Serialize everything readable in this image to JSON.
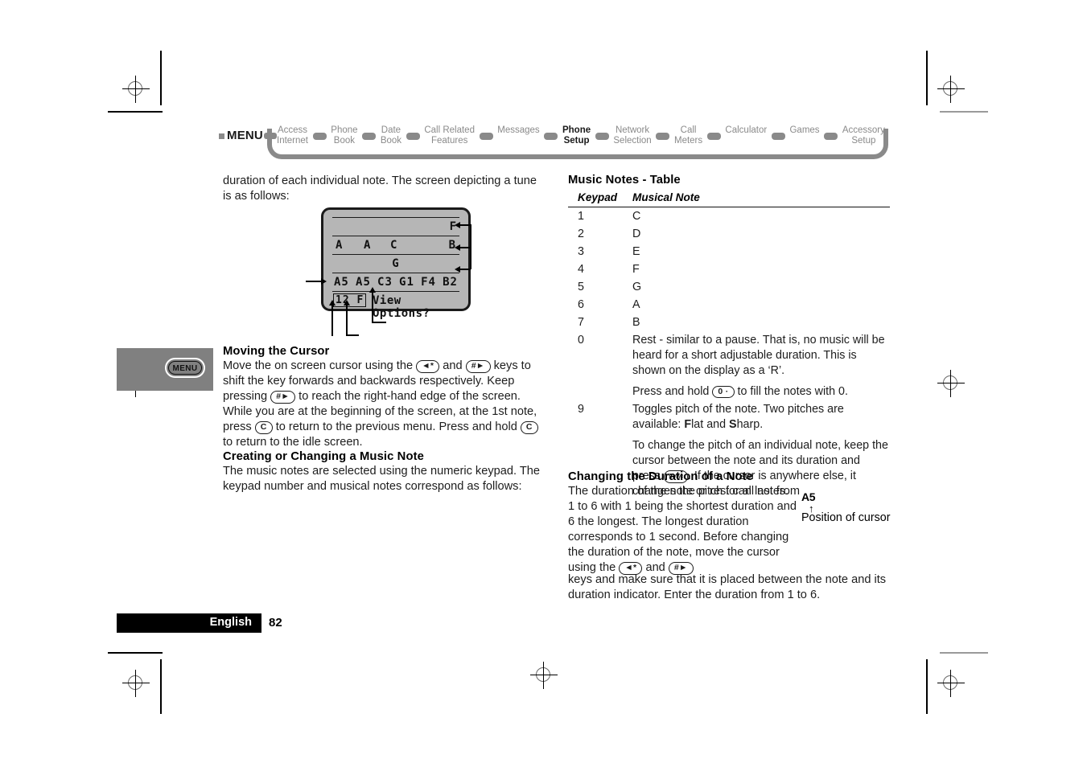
{
  "nav": {
    "menu_label": "MENU",
    "items": [
      {
        "label": "Access\nInternet",
        "active": false
      },
      {
        "label": "Phone\nBook",
        "active": false
      },
      {
        "label": "Date\nBook",
        "active": false
      },
      {
        "label": "Call Related\nFeatures",
        "active": false
      },
      {
        "label": "Messages",
        "active": false
      },
      {
        "label": "Phone\nSetup",
        "active": true
      },
      {
        "label": "Network\nSelection",
        "active": false
      },
      {
        "label": "Call\nMeters",
        "active": false
      },
      {
        "label": "Calculator",
        "active": false
      },
      {
        "label": "Games",
        "active": false
      },
      {
        "label": "Accessory\nSetup",
        "active": false
      }
    ]
  },
  "left": {
    "intro": "duration of each individual note. The screen depicting a tune is as follows:",
    "phone_screen": {
      "row1_note": "F",
      "row2_notes": [
        "A",
        "A",
        "C",
        "B"
      ],
      "row3_note": "G",
      "row4_notes": [
        "A5",
        "A5",
        "C3",
        "G1",
        "F4",
        "B2"
      ],
      "duration_box": "12 F",
      "softkey": "View Options?"
    },
    "moving_cursor": {
      "heading": "Moving the Cursor",
      "p1_a": "Move the on screen cursor using the",
      "key_star": "◄*",
      "p1_b": "and",
      "key_hash": "#►",
      "p1_c": "keys to shift the key forwards and backwards respectively. Keep pressing",
      "p1_d": "to reach the right-hand edge of the screen. While you are at the beginning of the screen, at the 1st note, press",
      "key_c": "C",
      "p1_e": "to return to the previous menu. Press and hold",
      "p1_f": "to return to the idle screen."
    },
    "creating_note": {
      "heading": "Creating or Changing a Music Note",
      "body": "The music notes are selected using the numeric keypad. The keypad number and musical notes correspond as follows:"
    },
    "icon_panel": {
      "menu_button_label": "MENU"
    }
  },
  "right": {
    "table": {
      "title": "Music Notes - Table",
      "columns": [
        "Keypad",
        "Musical Note"
      ],
      "rows": [
        {
          "keypad": "1",
          "note": "C"
        },
        {
          "keypad": "2",
          "note": "D"
        },
        {
          "keypad": "3",
          "note": "E"
        },
        {
          "keypad": "4",
          "note": "F"
        },
        {
          "keypad": "5",
          "note": "G"
        },
        {
          "keypad": "6",
          "note": "A"
        },
        {
          "keypad": "7",
          "note": "B"
        }
      ],
      "row_zero": {
        "keypad": "0",
        "para1": "Rest - similar to a pause. That is, no music will be heard for a short adjustable duration. This is shown on the display as a ‘R’.",
        "para2_a": "Press and hold",
        "key_zero": "0 ·",
        "para2_b": "to fill the notes with 0."
      },
      "row_nine": {
        "keypad": "9",
        "para1_a": "Toggles pitch of the note. Two pitches are available: ",
        "para1_flat_bold": "F",
        "para1_flat_rest": "lat and ",
        "para1_sharp_bold": "S",
        "para1_sharp_rest": "harp.",
        "para2_a": "To change the pitch of an individual note, keep the cursor between the note and its duration and press",
        "key_nine": "9",
        "key_nine_sub": "wxyz",
        "para2_b": ". If the cursor is anywhere else, it changes the pitch for all notes."
      }
    },
    "duration": {
      "heading": "Changing the Duration of a Note",
      "p_a": "The duration of the note or rest can last from 1 to 6 with 1 being the shortest duration and 6 the longest. The longest duration corresponds to 1 second. Before changing the duration of the note, move the cursor using the",
      "key_star": "◄*",
      "p_b": "and",
      "key_hash": "#►",
      "p_c": "keys and make sure that it is placed between the note and its duration indicator. Enter the duration from 1 to 6."
    },
    "cursor_callout": {
      "value": "A5",
      "arrow": "↑",
      "label": "Position of cursor"
    }
  },
  "footer": {
    "language": "English",
    "page_number": "82"
  },
  "colors": {
    "ribbon_gray": "#8a8a8a",
    "panel_gray": "#808080",
    "lcd_gray": "#b6b6b6",
    "ink": "#1d1d1d"
  }
}
